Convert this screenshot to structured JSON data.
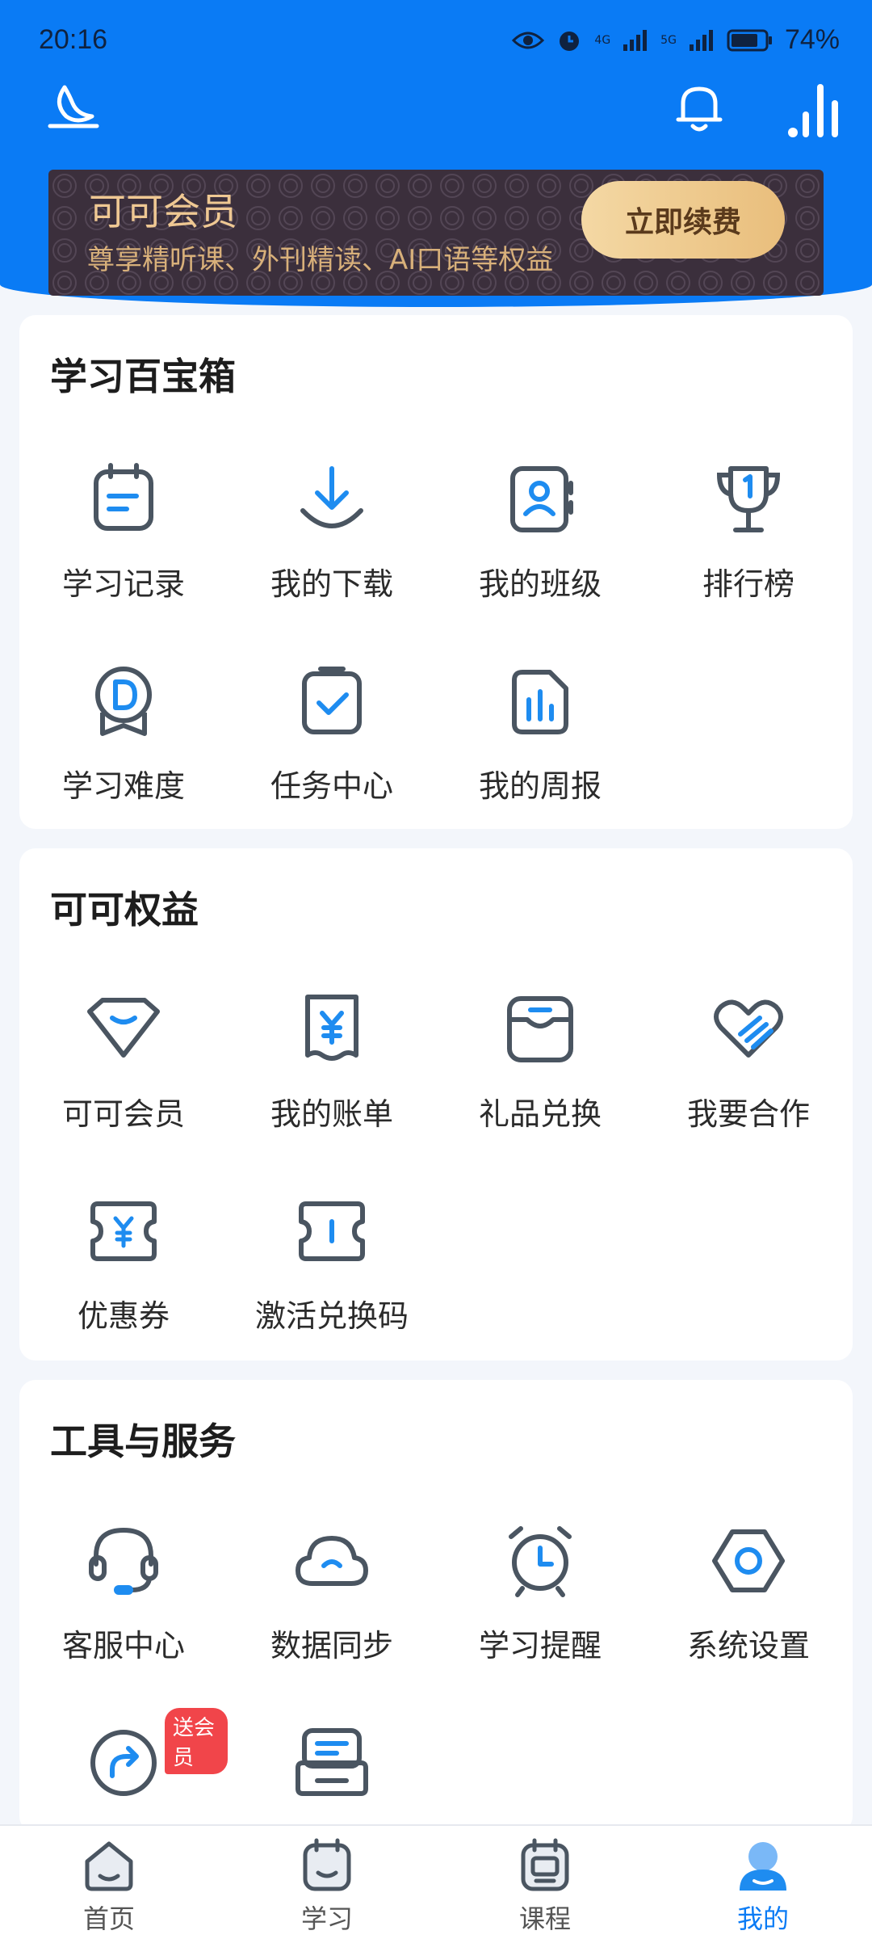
{
  "status_bar": {
    "time": "20:16",
    "battery": "74%",
    "net1": "4G",
    "net2": "5G"
  },
  "vip_banner": {
    "title": "可可会员",
    "subtitle": "尊享精听课、外刊精读、AI口语等权益",
    "button": "立即续费"
  },
  "sections": {
    "toolbox": {
      "title": "学习百宝箱",
      "items": [
        {
          "label": "学习记录",
          "icon": "study-record-icon"
        },
        {
          "label": "我的下载",
          "icon": "download-icon"
        },
        {
          "label": "我的班级",
          "icon": "class-icon"
        },
        {
          "label": "排行榜",
          "icon": "trophy-icon"
        },
        {
          "label": "学习难度",
          "icon": "difficulty-badge-icon"
        },
        {
          "label": "任务中心",
          "icon": "task-clipboard-icon"
        },
        {
          "label": "我的周报",
          "icon": "weekly-report-icon"
        }
      ]
    },
    "benefits": {
      "title": "可可权益",
      "items": [
        {
          "label": "可可会员",
          "icon": "diamond-icon"
        },
        {
          "label": "我的账单",
          "icon": "bill-icon"
        },
        {
          "label": "礼品兑换",
          "icon": "gift-box-icon"
        },
        {
          "label": "我要合作",
          "icon": "handshake-heart-icon"
        },
        {
          "label": "优惠券",
          "icon": "coupon-icon"
        },
        {
          "label": "激活兑换码",
          "icon": "ticket-icon"
        }
      ]
    },
    "tools": {
      "title": "工具与服务",
      "items": [
        {
          "label": "客服中心",
          "icon": "headset-icon"
        },
        {
          "label": "数据同步",
          "icon": "cloud-sync-icon"
        },
        {
          "label": "学习提醒",
          "icon": "alarm-clock-icon"
        },
        {
          "label": "系统设置",
          "icon": "settings-hex-icon"
        },
        {
          "label": "",
          "icon": "share-arrow-icon",
          "badge": "送会员"
        },
        {
          "label": "",
          "icon": "printer-icon"
        }
      ]
    }
  },
  "tabbar": {
    "items": [
      {
        "label": "首页",
        "icon": "home-icon"
      },
      {
        "label": "学习",
        "icon": "study-icon"
      },
      {
        "label": "课程",
        "icon": "course-icon"
      },
      {
        "label": "我的",
        "icon": "profile-icon",
        "active": true
      }
    ]
  },
  "colors": {
    "accent": "#0a7bf5",
    "icon_stroke": "#4a5561",
    "icon_accent": "#1e8cf0",
    "vip_gold": "#efc893"
  }
}
